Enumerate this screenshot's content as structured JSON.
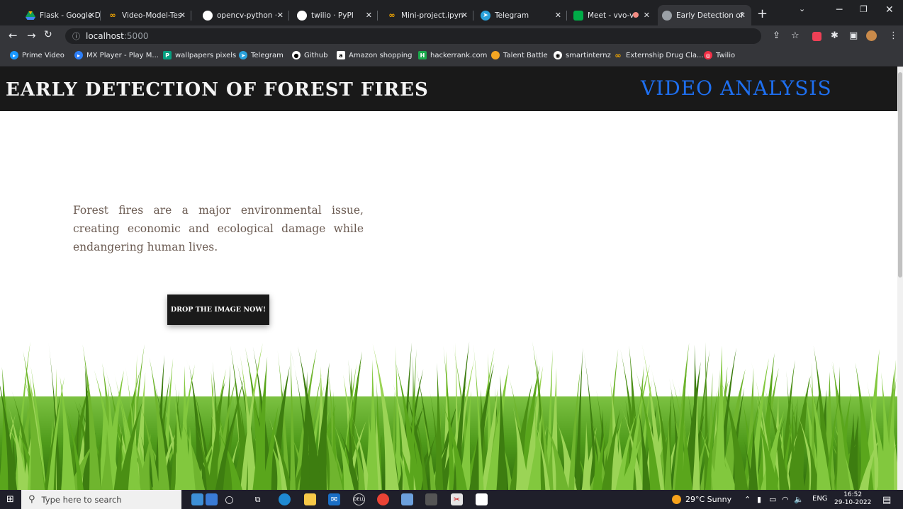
{
  "browser": {
    "tabs": [
      {
        "label": "Flask - Google Dr",
        "icon": "google-drive-icon",
        "color": "#f4b400"
      },
      {
        "label": "Video-Model-Tes",
        "icon": "colab-icon",
        "color": "#f9ab00"
      },
      {
        "label": "opencv-python ·",
        "icon": "pypi-icon",
        "color": "#ffffff"
      },
      {
        "label": "twilio · PyPI",
        "icon": "pypi-icon",
        "color": "#ffffff"
      },
      {
        "label": "Mini-project.ipyn",
        "icon": "colab-icon",
        "color": "#f9ab00"
      },
      {
        "label": "Telegram",
        "icon": "telegram-icon",
        "color": "#2aa1da"
      },
      {
        "label": "Meet - vvo-v",
        "icon": "meet-icon",
        "color": "#00ac47"
      },
      {
        "label": "Early Detection of",
        "icon": "globe-icon",
        "color": "#9aa0a6"
      }
    ],
    "url_host": "localhost",
    "url_port": ":5000",
    "bookmarks": [
      {
        "label": "Prime Video",
        "color": "#1a98ff"
      },
      {
        "label": "MX Player - Play M...",
        "color": "#2d7ff9"
      },
      {
        "label": "wallpapers pixels",
        "color": "#05a081"
      },
      {
        "label": "Telegram",
        "color": "#2aa1da"
      },
      {
        "label": "Github",
        "color": "#ffffff"
      },
      {
        "label": "Amazon shopping",
        "color": "#ffffff"
      },
      {
        "label": "hackerrank.com",
        "color": "#1ba94c"
      },
      {
        "label": "Talent Battle",
        "color": "#f5a623"
      },
      {
        "label": "smartinternz",
        "color": "#ffffff"
      },
      {
        "label": "Externship Drug Cla...",
        "color": "#f9ab00"
      },
      {
        "label": "Twilio",
        "color": "#f22f46"
      }
    ]
  },
  "page": {
    "title": "EARLY DETECTION OF FOREST FIRES",
    "video_link": "VIDEO ANALYSIS",
    "intro": "Forest fires are a major environmental issue, creating economic and ecological damage while endangering human lives.",
    "drop_button": "DROP THE IMAGE NOW!"
  },
  "taskbar": {
    "search_placeholder": "Type here to search",
    "weather": "29°C Sunny",
    "language": "ENG",
    "time": "16:52",
    "date": "29-10-2022"
  },
  "colors": {
    "header_bg": "#191919",
    "link_blue": "#1e6ff0",
    "grass_green": "#5aa61c"
  }
}
